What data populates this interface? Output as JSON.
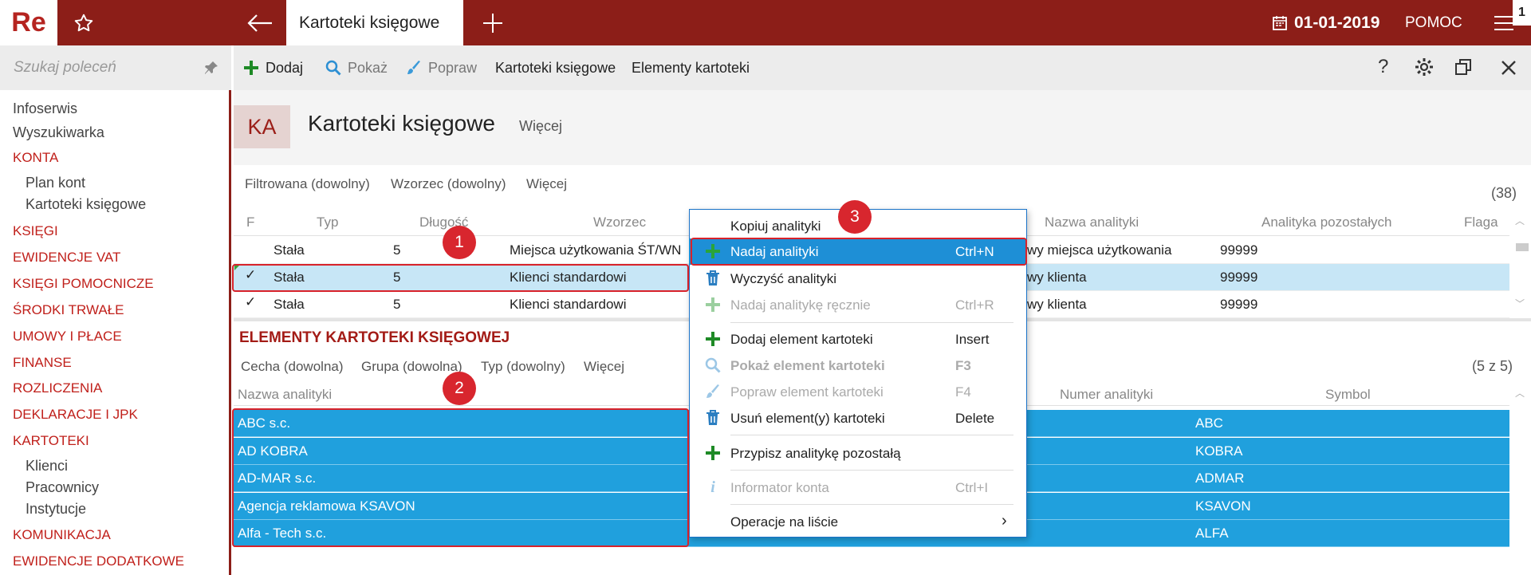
{
  "app": {
    "logo": "Re",
    "tab_title": "Kartoteki księgowe",
    "date": "01-01-2019",
    "help": "POMOC",
    "badge": "1"
  },
  "sidebar": {
    "search_placeholder": "Szukaj poleceń",
    "items": [
      {
        "label": "Infoserwis",
        "type": "plain"
      },
      {
        "label": "Wyszukiwarka",
        "type": "plain"
      },
      {
        "label": "KONTA",
        "type": "section"
      },
      {
        "label": "Plan kont",
        "type": "sub"
      },
      {
        "label": "Kartoteki księgowe",
        "type": "sub"
      },
      {
        "label": "KSIĘGI",
        "type": "section"
      },
      {
        "label": "EWIDENCJE VAT",
        "type": "section"
      },
      {
        "label": "KSIĘGI POMOCNICZE",
        "type": "section"
      },
      {
        "label": "ŚRODKI TRWAŁE",
        "type": "section"
      },
      {
        "label": "UMOWY I PŁACE",
        "type": "section"
      },
      {
        "label": "FINANSE",
        "type": "section"
      },
      {
        "label": "ROZLICZENIA",
        "type": "section"
      },
      {
        "label": "DEKLARACJE I JPK",
        "type": "section"
      },
      {
        "label": "KARTOTEKI",
        "type": "section"
      },
      {
        "label": "Klienci",
        "type": "sub"
      },
      {
        "label": "Pracownicy",
        "type": "sub"
      },
      {
        "label": "Instytucje",
        "type": "sub"
      },
      {
        "label": "KOMUNIKACJA",
        "type": "section"
      },
      {
        "label": "EWIDENCJE DODATKOWE",
        "type": "section"
      }
    ]
  },
  "toolbar": {
    "add": "Dodaj",
    "show": "Pokaż",
    "edit": "Popraw",
    "cards": "Kartoteki księgowe",
    "elements": "Elementy kartoteki"
  },
  "page": {
    "badge": "KA",
    "title": "Kartoteki księgowe",
    "more": "Więcej"
  },
  "filters1": {
    "f1": "Filtrowana (dowolny)",
    "f2": "Wzorzec (dowolny)",
    "more": "Więcej",
    "count": "(38)"
  },
  "grid1": {
    "columns": [
      "F",
      "Typ",
      "Długość",
      "Wzorzec",
      "Nazwa analityki",
      "Analityka pozostałych",
      "Flaga"
    ],
    "rows": [
      {
        "f": "",
        "typ": "Stała",
        "dl": "5",
        "wz": "Miejsca użytkowania ŚT/WN",
        "naz": "wy miejsca użytkowania",
        "pozost": "99999"
      },
      {
        "f": "✓",
        "typ": "Stała",
        "dl": "5",
        "wz": "Klienci standardowi",
        "naz": "wy klienta",
        "pozost": "99999"
      },
      {
        "f": "✓",
        "typ": "Stała",
        "dl": "5",
        "wz": "Klienci standardowi",
        "naz": "wy klienta",
        "pozost": "99999"
      }
    ]
  },
  "grid2": {
    "title": "ELEMENTY KARTOTEKI KSIĘGOWEJ",
    "filters": {
      "f1": "Cecha (dowolna)",
      "f2": "Grupa (dowolna)",
      "f3": "Typ (dowolny)",
      "more": "Więcej",
      "count": "(5 z 5)"
    },
    "columns": [
      "Nazwa analityki",
      "Numer analityki",
      "Symbol"
    ],
    "rows": [
      {
        "name": "ABC s.c.",
        "symbol": "ABC"
      },
      {
        "name": "AD KOBRA",
        "symbol": "KOBRA"
      },
      {
        "name": "AD-MAR s.c.",
        "symbol": "ADMAR"
      },
      {
        "name": "Agencja reklamowa KSAVON",
        "symbol": "KSAVON"
      },
      {
        "name": "Alfa - Tech s.c.",
        "symbol": "ALFA"
      }
    ]
  },
  "menu": {
    "items": [
      {
        "label": "Kopiuj analityki",
        "shortcut": ""
      },
      {
        "label": "Nadaj analityki",
        "shortcut": "Ctrl+N"
      },
      {
        "label": "Wyczyść analityki",
        "shortcut": ""
      },
      {
        "label": "Nadaj analitykę ręcznie",
        "shortcut": "Ctrl+R"
      },
      {
        "label": "Dodaj element kartoteki",
        "shortcut": "Insert"
      },
      {
        "label": "Pokaż element kartoteki",
        "shortcut": "F3"
      },
      {
        "label": "Popraw element kartoteki",
        "shortcut": "F4"
      },
      {
        "label": "Usuń element(y) kartoteki",
        "shortcut": "Delete"
      },
      {
        "label": "Przypisz analitykę pozostałą",
        "shortcut": ""
      },
      {
        "label": "Informator konta",
        "shortcut": "Ctrl+I"
      },
      {
        "label": "Operacje na liście",
        "shortcut": "›"
      }
    ]
  },
  "callouts": [
    "1",
    "2",
    "3"
  ],
  "colors": {
    "brand": "#8c1e18",
    "accent_red": "#c0201b",
    "selection": "#20a0dd",
    "menu_highlight": "#1e8fd6",
    "callout": "#d8262e"
  }
}
